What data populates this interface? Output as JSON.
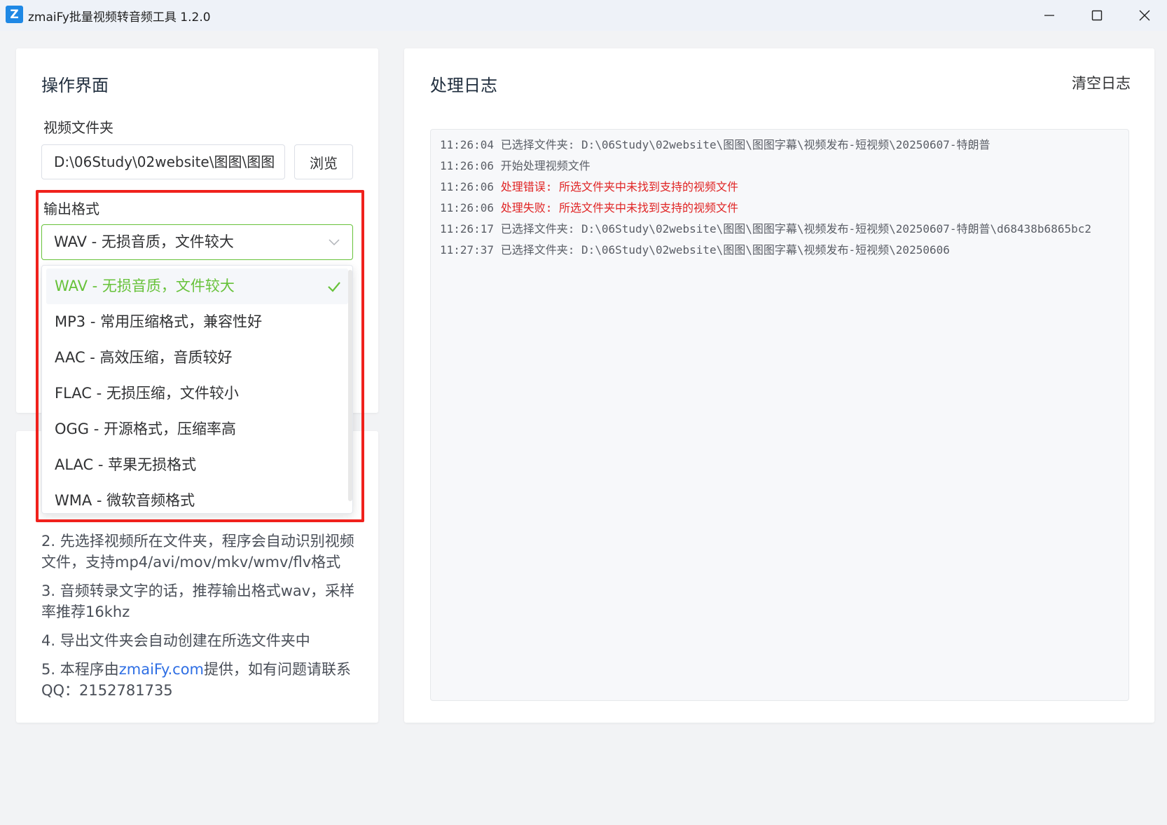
{
  "window": {
    "title": "zmaiFy批量视频转音频工具 1.2.0",
    "icon_glyph": "Z",
    "controls": {
      "minimize": "—",
      "maximize": "☐",
      "close": "✕"
    }
  },
  "ops": {
    "title": "操作界面",
    "folder_label": "视频文件夹",
    "folder_value": "D:\\06Study\\02website\\图图\\图图",
    "browse_label": "浏览",
    "format_label": "输出格式",
    "selected_format": "WAV - 无损音质，文件较大",
    "options": [
      {
        "label": "WAV - 无损音质，文件较大",
        "selected": true
      },
      {
        "label": "MP3 - 常用压缩格式，兼容性好",
        "selected": false
      },
      {
        "label": "AAC - 高效压缩，音质较好",
        "selected": false
      },
      {
        "label": "FLAC - 无损压缩，文件较小",
        "selected": false
      },
      {
        "label": "OGG - 开源格式，压缩率高",
        "selected": false
      },
      {
        "label": "ALAC - 苹果无损格式",
        "selected": false
      },
      {
        "label": "WMA - 微软音频格式",
        "selected": false
      }
    ]
  },
  "help": {
    "line2": "2. 先选择视频所在文件夹，程序会自动识别视频文件，支持mp4/avi/mov/mkv/wmv/flv格式",
    "line3": "3. 音频转录文字的话，推荐输出格式wav，采样率推荐16khz",
    "line4": "4. 导出文件夹会自动创建在所选文件夹中",
    "line5_prefix": "5. 本程序由",
    "line5_link": "zmaiFy.com",
    "line5_suffix": "提供，如有问题请联系QQ：2152781735"
  },
  "log": {
    "title": "处理日志",
    "clear_label": "清空日志",
    "entries": [
      {
        "time": "11:26:04",
        "label": "已选择文件夹:",
        "message": "D:\\06Study\\02website\\图图\\图图字幕\\视频发布-短视频\\20250607-特朗普",
        "error": false
      },
      {
        "time": "11:26:06",
        "label": "开始处理视频文件",
        "message": "",
        "error": false
      },
      {
        "time": "11:26:06",
        "label": "处理错误:",
        "message": "所选文件夹中未找到支持的视频文件",
        "error": true
      },
      {
        "time": "11:26:06",
        "label": "处理失败:",
        "message": "所选文件夹中未找到支持的视频文件",
        "error": true
      },
      {
        "time": "11:26:17",
        "label": "已选择文件夹:",
        "message": "D:\\06Study\\02website\\图图\\图图字幕\\视频发布-短视频\\20250607-特朗普\\d68438b6865bc2",
        "error": false
      },
      {
        "time": "11:27:37",
        "label": "已选择文件夹:",
        "message": "D:\\06Study\\02website\\图图\\图图字幕\\视频发布-短视频\\20250606",
        "error": false
      }
    ]
  },
  "colors": {
    "accent_green": "#67c23a",
    "error_red": "#e02424",
    "highlight_red": "#f0211c",
    "link_blue": "#2f6fe4"
  }
}
